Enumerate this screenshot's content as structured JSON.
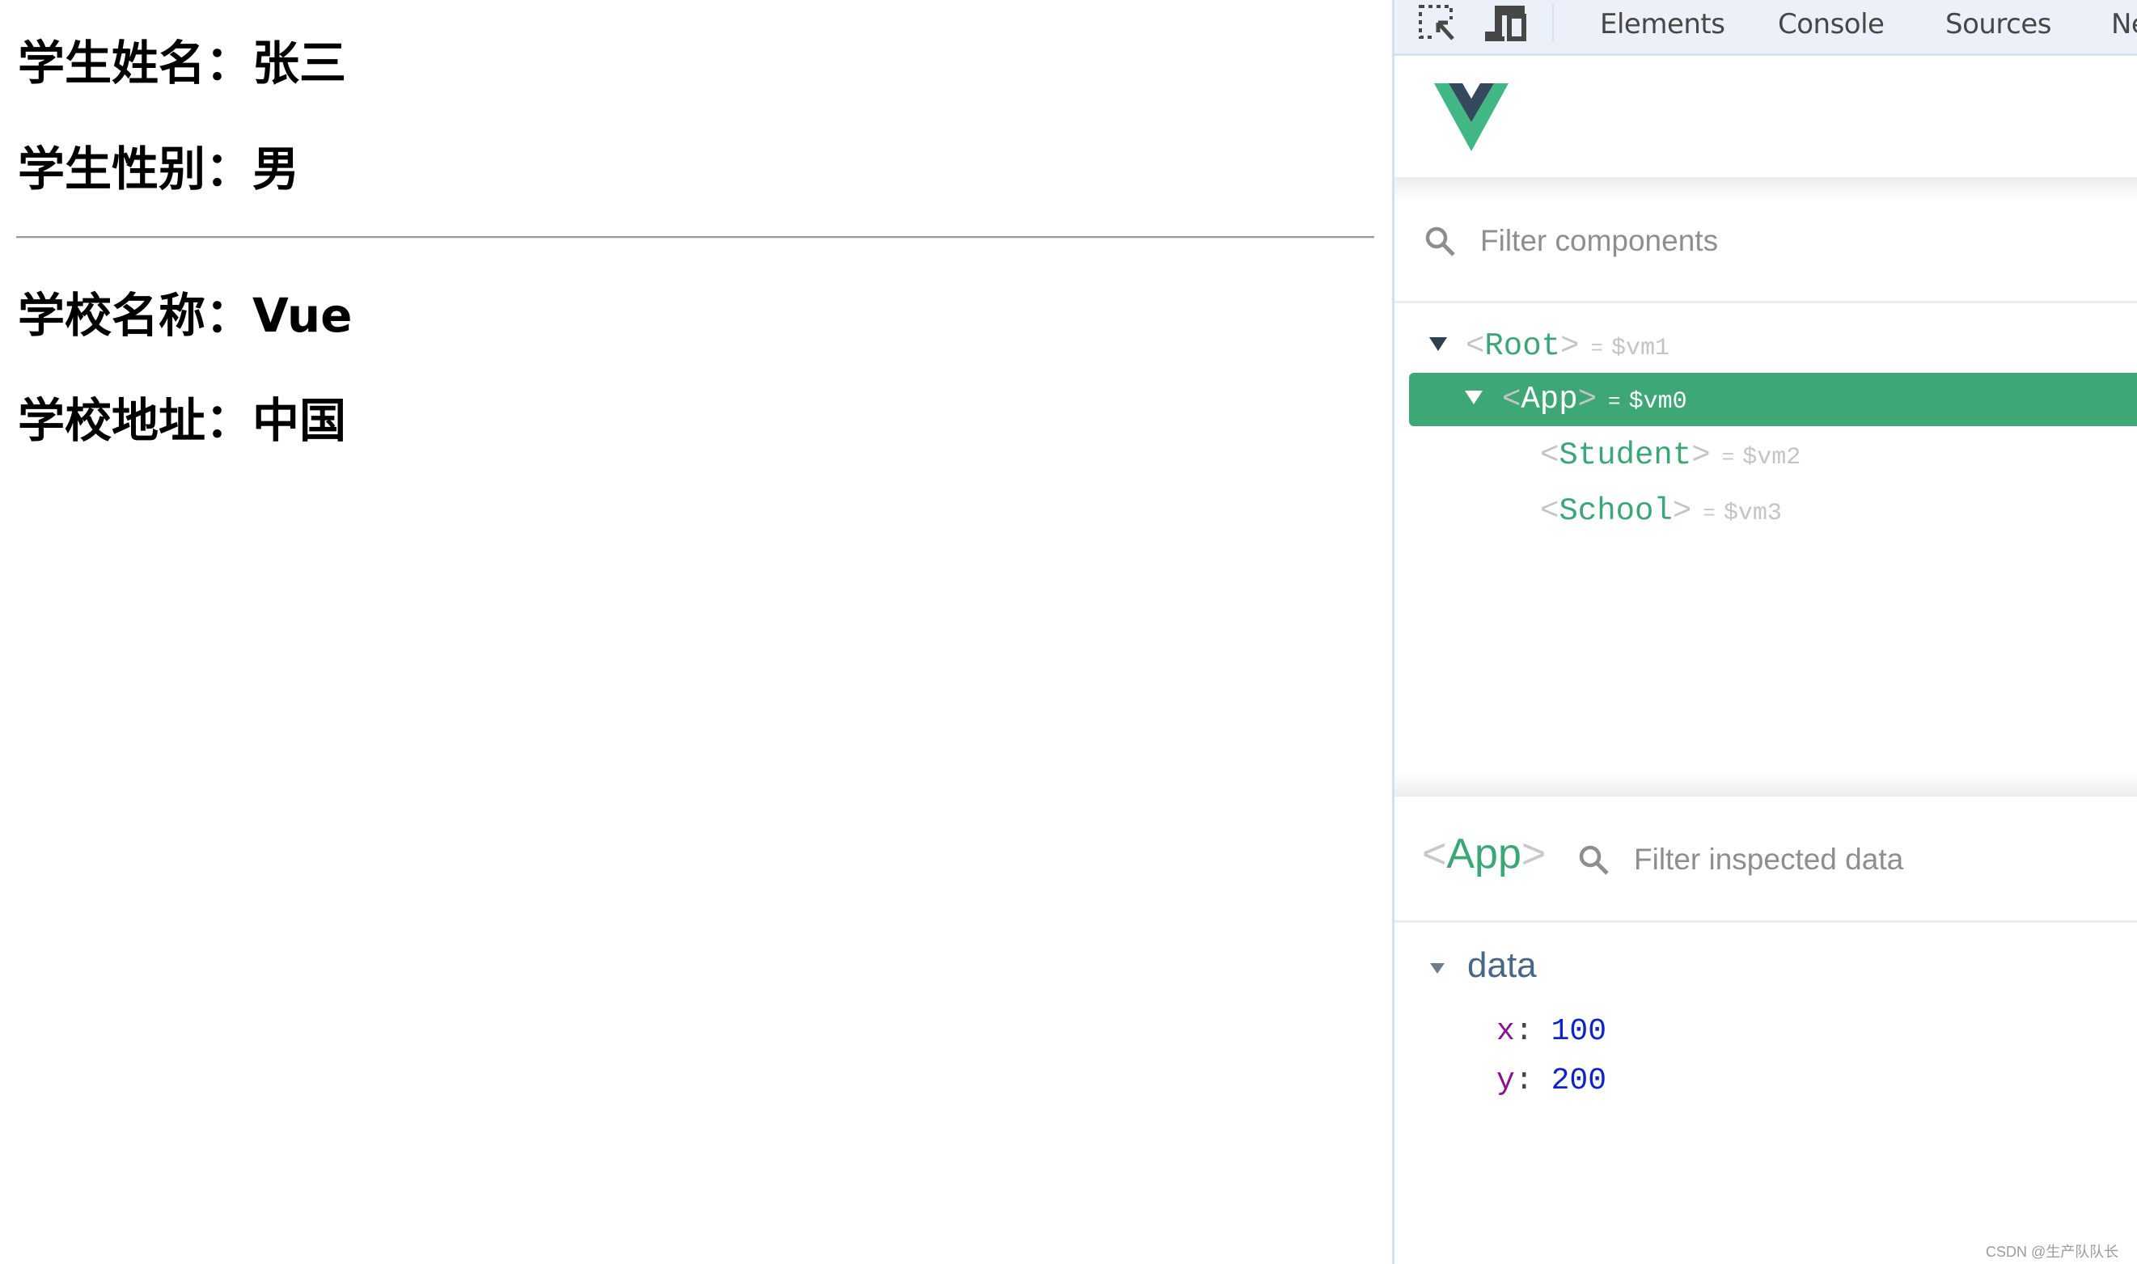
{
  "page": {
    "student": [
      {
        "label": "学生姓名：",
        "value": "张三"
      },
      {
        "label": "学生性别：",
        "value": "男"
      }
    ],
    "school": [
      {
        "label": "学校名称：",
        "value": "Vue"
      },
      {
        "label": "学校地址：",
        "value": "中国"
      }
    ]
  },
  "devtools": {
    "toolbar": {
      "icons": [
        "inspect-element-icon",
        "device-toolbar-icon"
      ],
      "tabs": [
        "Elements",
        "Console",
        "Sources",
        "Ne"
      ]
    },
    "vue": {
      "logo": "vue-logo",
      "colors": {
        "green": "#3ea776",
        "dark": "#35495e"
      },
      "filter_components_placeholder": "Filter components",
      "tree": [
        {
          "name": "Root",
          "vm": "$vm1",
          "expanded": true,
          "selected": false
        },
        {
          "name": "App",
          "vm": "$vm0",
          "expanded": true,
          "selected": true
        },
        {
          "name": "Student",
          "vm": "$vm2",
          "expanded": false,
          "selected": false
        },
        {
          "name": "School",
          "vm": "$vm3",
          "expanded": false,
          "selected": false
        }
      ],
      "inspector": {
        "component": "App",
        "filter_placeholder": "Filter inspected data",
        "section": "data",
        "props": [
          {
            "key": "x",
            "value": "100"
          },
          {
            "key": "y",
            "value": "200"
          }
        ]
      }
    }
  },
  "symbols": {
    "lt": "<",
    "gt": ">",
    "eq": "=",
    "colon": ":"
  },
  "watermark": "CSDN @生产队队长"
}
